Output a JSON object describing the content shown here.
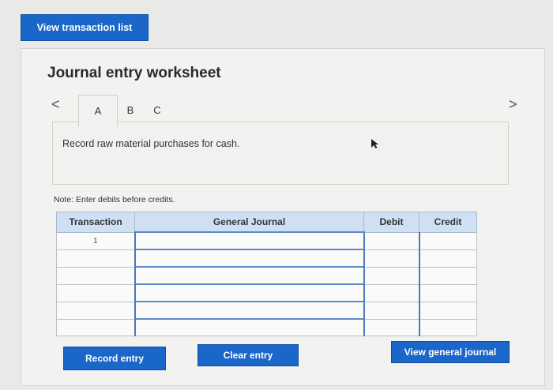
{
  "header": {
    "view_list_label": "View transaction list"
  },
  "worksheet": {
    "title": "Journal entry worksheet",
    "tabs": [
      "A",
      "B",
      "C"
    ],
    "instruction": "Record raw material purchases for cash.",
    "note": "Note: Enter debits before credits.",
    "table": {
      "columns": [
        "Transaction",
        "General Journal",
        "Debit",
        "Credit"
      ],
      "rows": [
        {
          "transaction": "1",
          "account": "",
          "debit": "",
          "credit": ""
        },
        {
          "transaction": "",
          "account": "",
          "debit": "",
          "credit": ""
        },
        {
          "transaction": "",
          "account": "",
          "debit": "",
          "credit": ""
        },
        {
          "transaction": "",
          "account": "",
          "debit": "",
          "credit": ""
        },
        {
          "transaction": "",
          "account": "",
          "debit": "",
          "credit": ""
        },
        {
          "transaction": "",
          "account": "",
          "debit": "",
          "credit": ""
        }
      ]
    },
    "buttons": {
      "record_entry": "Record entry",
      "clear_entry": "Clear entry",
      "view_general_journal": "View general journal"
    },
    "nav": {
      "prev": "<",
      "next": ">"
    }
  },
  "colors": {
    "accent": "#1a66c9",
    "header_fill": "#cfe0f4",
    "panel_bg": "#f2f2f0"
  }
}
